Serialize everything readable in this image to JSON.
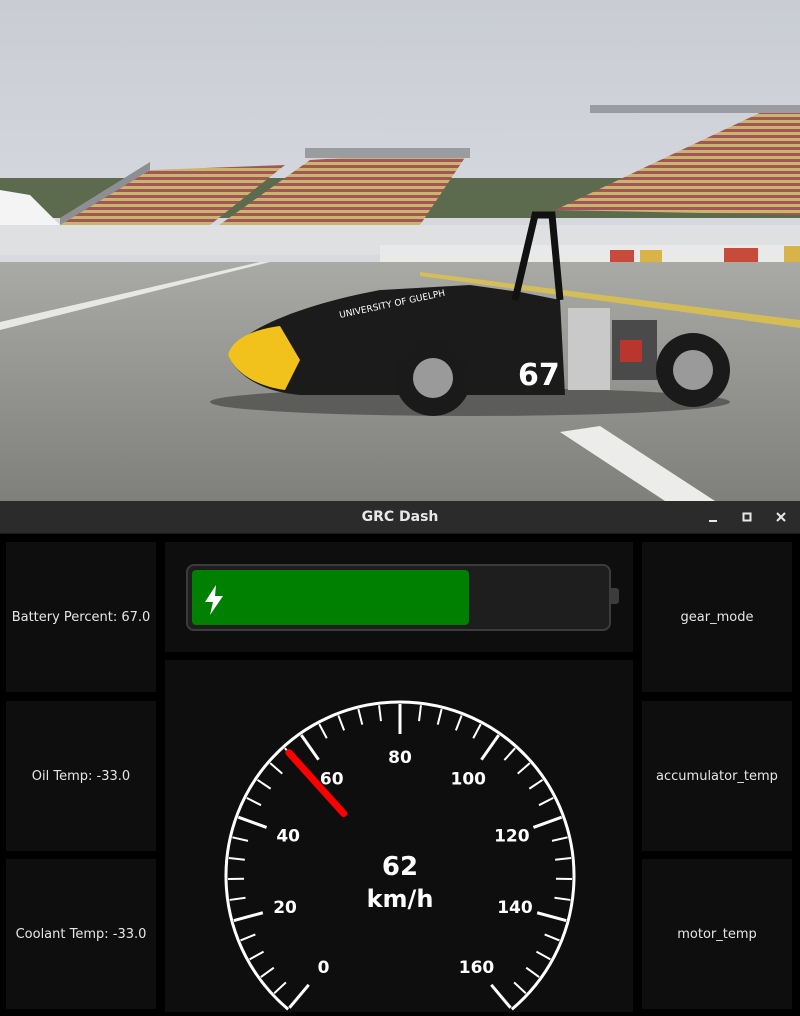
{
  "photo": {
    "car_number": "67",
    "sponsor_text": "UNIVERSITY OF GUELPH"
  },
  "window": {
    "title": "GRC Dash",
    "controls": {
      "minimize_icon": "minimize-icon",
      "maximize_icon": "maximize-icon",
      "close_icon": "close-icon"
    }
  },
  "left_panels": {
    "battery_percent": "Battery Percent: 67.0",
    "oil_temp": "Oil Temp: -33.0",
    "coolant_temp": "Coolant Temp: -33.0"
  },
  "right_panels": {
    "gear_mode": "gear_mode",
    "accumulator_temp": "accumulator_temp",
    "motor_temp": "motor_temp"
  },
  "battery": {
    "level": 0.67,
    "fill_color": "#008000",
    "icon": "lightning-bolt-icon"
  },
  "speedometer": {
    "speed": "62",
    "unit": "km/h",
    "min": 0,
    "max": 160,
    "major_labels": [
      "0",
      "20",
      "40",
      "60",
      "80",
      "100",
      "120",
      "140",
      "160"
    ],
    "needle_value": 56,
    "needle_color": "#ff0000"
  }
}
